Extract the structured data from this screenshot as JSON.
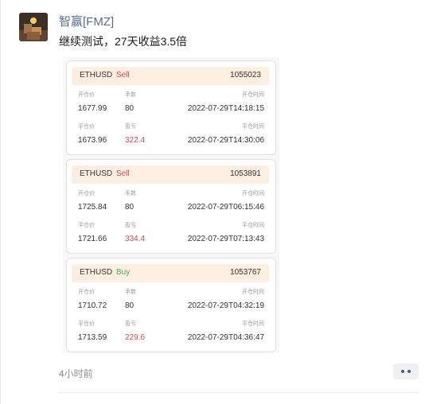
{
  "post": {
    "username": "智赢[FMZ]",
    "message": "继续测试，27天收益3.5倍",
    "timestamp": "4小时前"
  },
  "labels": {
    "open_price": "开仓价",
    "quantity": "手数",
    "open_time": "开仓时间",
    "close_price": "平仓价",
    "pnl": "盈亏",
    "close_time": "平仓时间"
  },
  "orders": [
    {
      "symbol": "ETHUSD",
      "side": "Sell",
      "order_no": "1055023",
      "open_price": "1677.99",
      "quantity": "80",
      "open_time": "2022-07-29T14:18:15",
      "close_price": "1673.96",
      "pnl": "322.4",
      "close_time": "2022-07-29T14:30:06"
    },
    {
      "symbol": "ETHUSD",
      "side": "Sell",
      "order_no": "1053891",
      "open_price": "1725.84",
      "quantity": "80",
      "open_time": "2022-07-29T06:15:46",
      "close_price": "1721.66",
      "pnl": "334.4",
      "close_time": "2022-07-29T07:13:43"
    },
    {
      "symbol": "ETHUSD",
      "side": "Buy",
      "order_no": "1053767",
      "open_price": "1710.72",
      "quantity": "80",
      "open_time": "2022-07-29T04:32:19",
      "close_price": "1713.59",
      "pnl": "229.6",
      "close_time": "2022-07-29T04:36:47"
    }
  ],
  "colors": {
    "sell": "#e2454e",
    "buy": "#3cae5c",
    "username": "#5a6a91",
    "card_header": "#fdeee2"
  }
}
